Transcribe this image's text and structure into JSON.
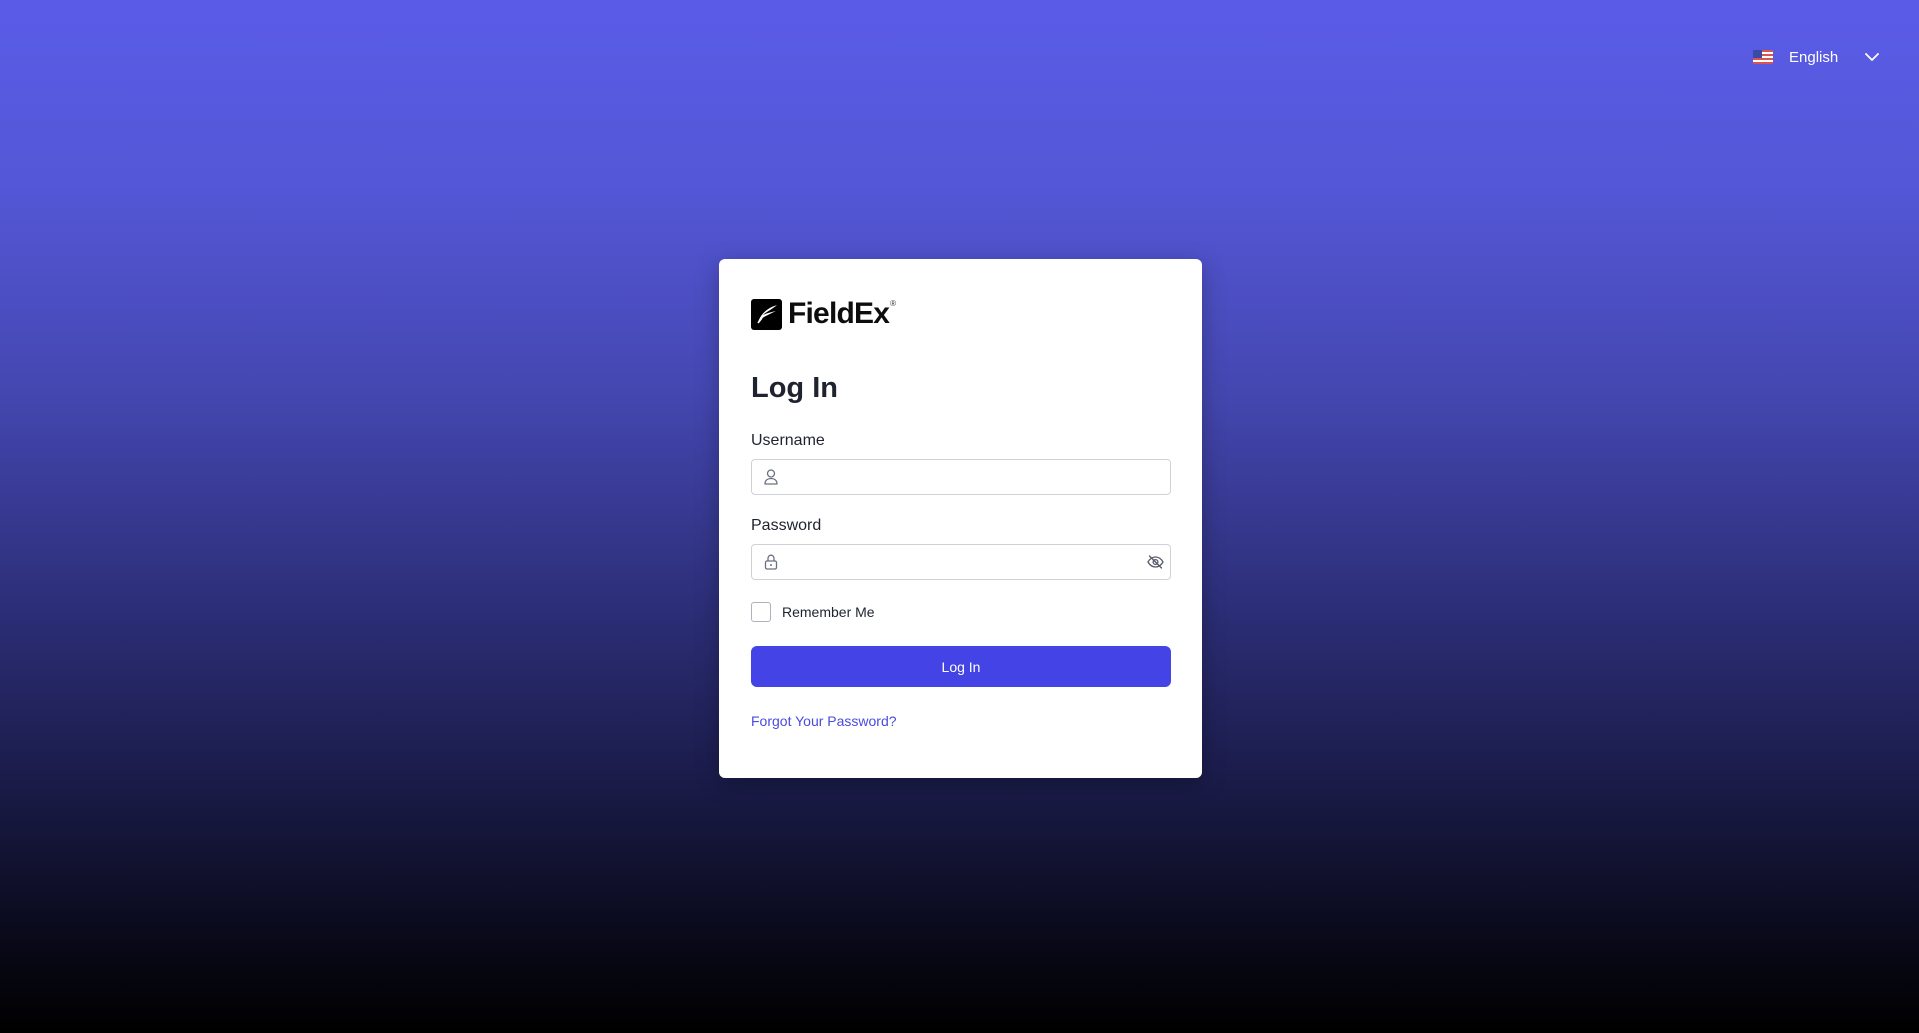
{
  "language": {
    "selected": "English",
    "flag_icon": "us-flag-icon"
  },
  "brand": {
    "name": "FieldEx",
    "reg_mark": "®"
  },
  "login": {
    "title": "Log In",
    "username_label": "Username",
    "username_value": "",
    "password_label": "Password",
    "password_value": "",
    "remember_label": "Remember Me",
    "remember_checked": false,
    "submit_label": "Log In",
    "forgot_label": "Forgot Your Password?"
  },
  "colors": {
    "primary": "#4343e6",
    "link": "#4a4ae0",
    "gradient_top": "#5a5ce8",
    "gradient_bottom": "#000000"
  }
}
